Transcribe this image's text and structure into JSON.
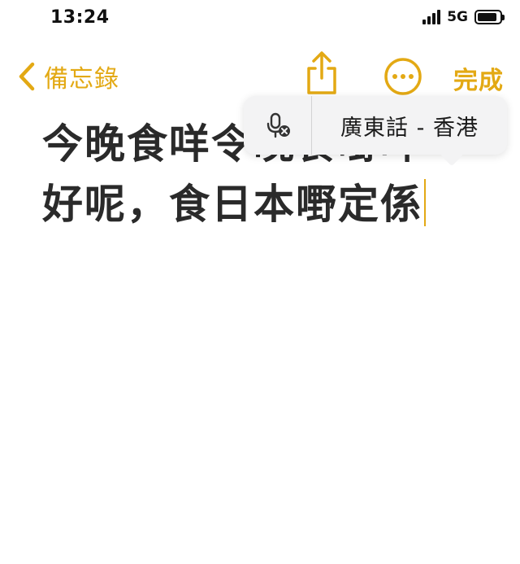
{
  "status_bar": {
    "time": "13:24",
    "network": "5G",
    "signal_bars": 4,
    "battery_level": 0.9,
    "icons": [
      "signal-icon",
      "battery-icon"
    ]
  },
  "nav": {
    "back_label": "備忘錄",
    "done_label": "完成",
    "icons": [
      "chevron-left-icon",
      "share-icon",
      "more-icon"
    ]
  },
  "note": {
    "lines": [
      "今晚食咩令晚食嘢咩",
      "好呢，食日本嘢定係"
    ]
  },
  "dictation": {
    "language": "廣東話 - 香港",
    "icon": "mic-off-icon"
  },
  "colors": {
    "accent": "#e3a914",
    "text": "#2a2a2a",
    "popup_bg": "#f3f3f4"
  }
}
